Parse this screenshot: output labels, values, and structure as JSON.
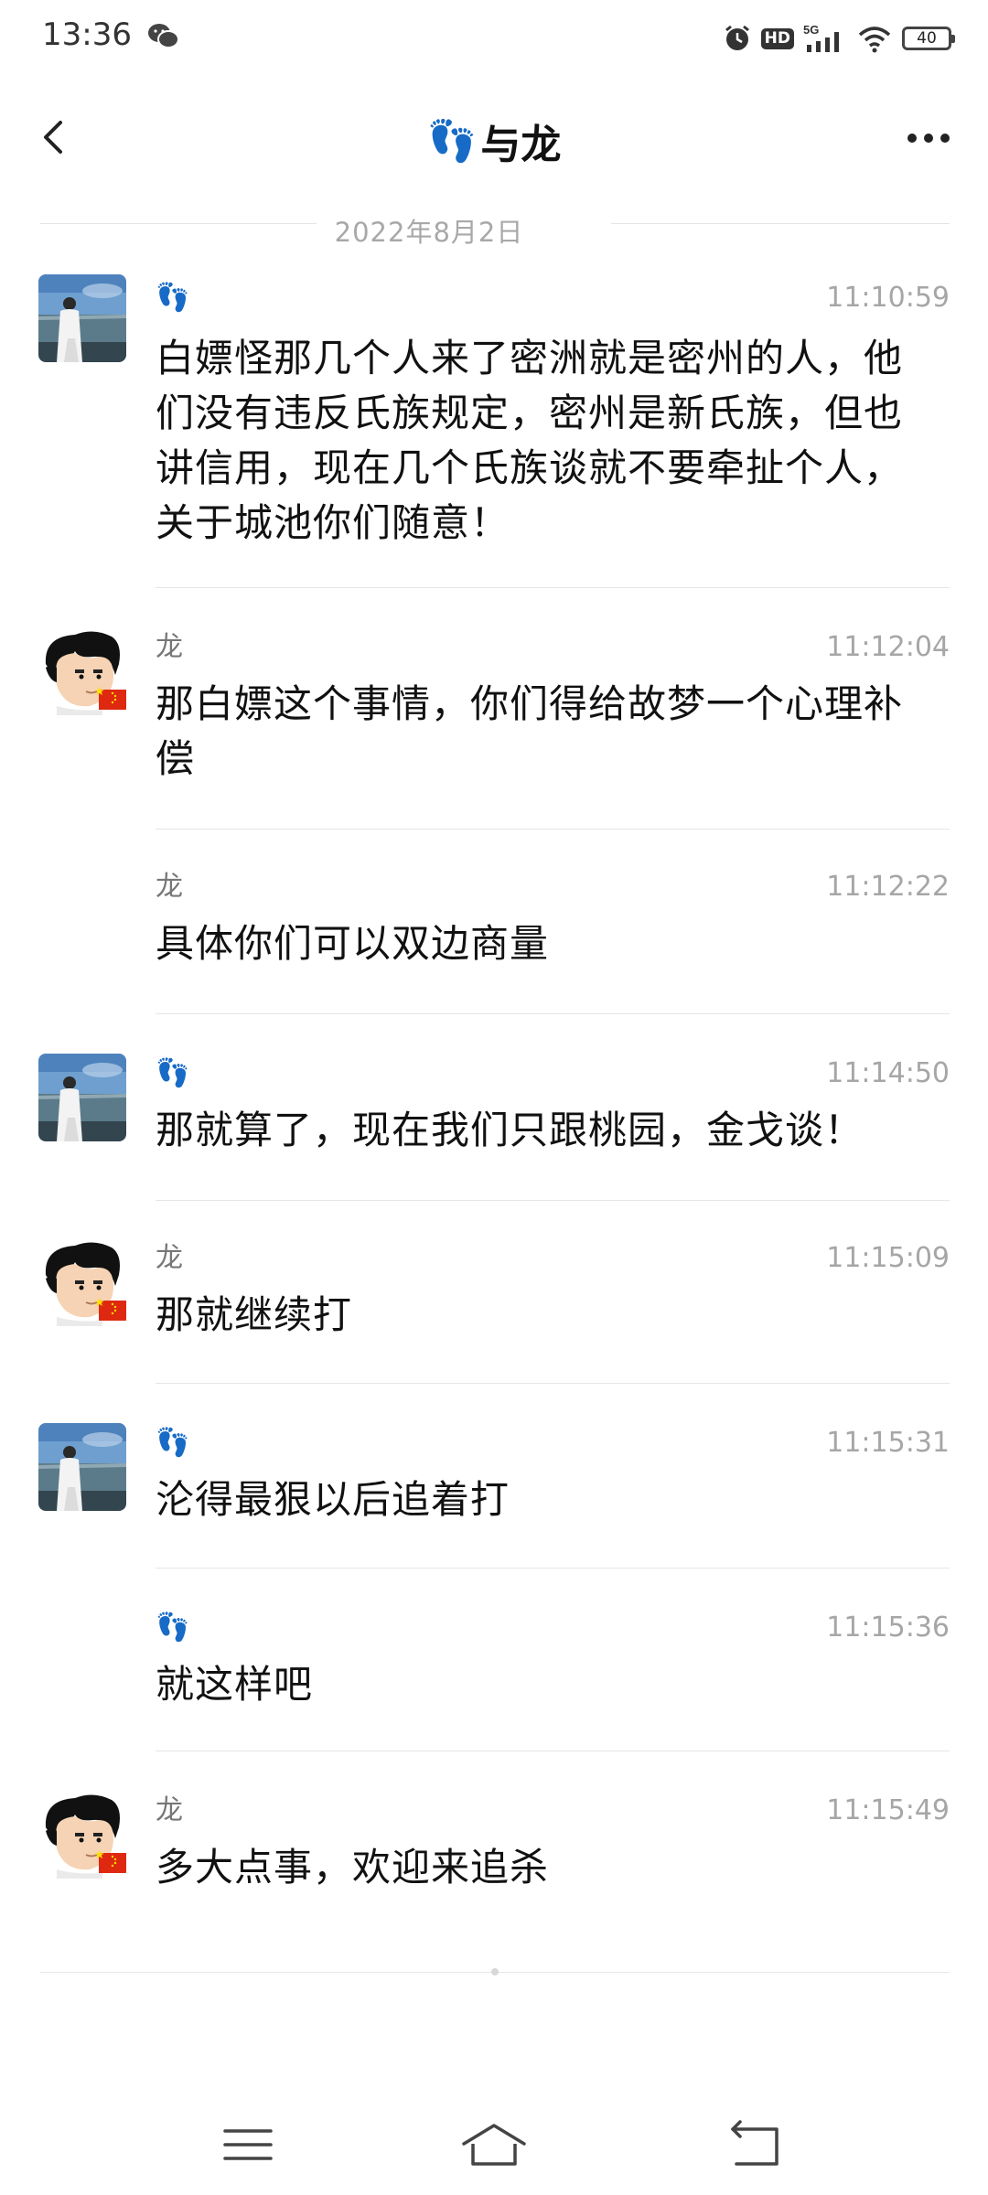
{
  "status_bar": {
    "time": "13:36",
    "network": "5G",
    "hd": "HD",
    "battery": "40",
    "icons": [
      "wechat-icon",
      "alarm-icon",
      "hd-icon",
      "signal-icon",
      "wifi-icon",
      "battery-icon"
    ]
  },
  "header": {
    "title_emoji": "👣",
    "title_text": "与龙",
    "back_icon": "chevron-left-icon",
    "more_icon": "more-dots-icon"
  },
  "date_divider": "2022年8月2日",
  "messages": [
    {
      "sender": "👣",
      "time": "11:10:59",
      "text": "白嫖怪那几个人来了密洲就是密州的人，他们没有违反氏族规定，密州是新氏族，但也讲信用，现在几个氏族谈就不要牵扯个人，关于城池你们随意！",
      "avatar": "sea-avatar"
    },
    {
      "sender": "龙",
      "time": "11:12:04",
      "text": "那白嫖这个事情，你们得给故梦一个心理补偿",
      "avatar": "cartoon-boy-avatar"
    },
    {
      "sender": "龙",
      "time": "11:12:22",
      "text": "具体你们可以双边商量",
      "avatar": ""
    },
    {
      "sender": "👣",
      "time": "11:14:50",
      "text": "那就算了，现在我们只跟桃园，金戈谈！",
      "avatar": "sea-avatar"
    },
    {
      "sender": "龙",
      "time": "11:15:09",
      "text": "那就继续打",
      "avatar": "cartoon-boy-avatar"
    },
    {
      "sender": "👣",
      "time": "11:15:31",
      "text": "沦得最狠以后追着打",
      "avatar": "sea-avatar"
    },
    {
      "sender": "👣",
      "time": "11:15:36",
      "text": "就这样吧",
      "avatar": ""
    },
    {
      "sender": "龙",
      "time": "11:15:49",
      "text": "多大点事，欢迎来追杀",
      "avatar": "cartoon-boy-avatar"
    }
  ],
  "nav_bar": {
    "icons": [
      "menu-icon",
      "home-icon",
      "back-icon"
    ]
  },
  "colors": {
    "divider": "#e6e6e6",
    "meta_text": "#a6a6a6"
  }
}
